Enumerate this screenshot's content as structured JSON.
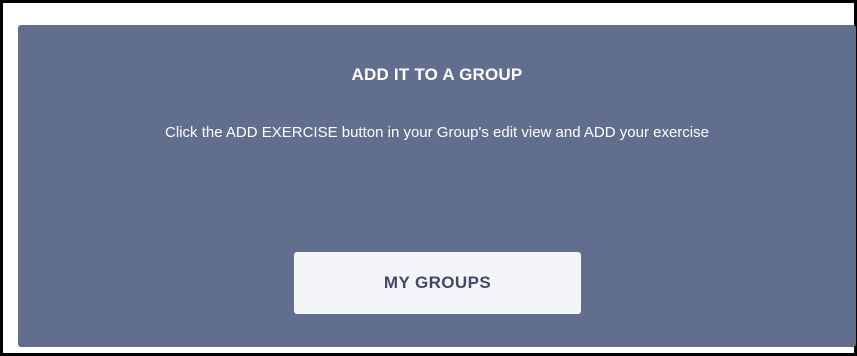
{
  "card": {
    "title": "ADD IT TO A GROUP",
    "description": "Click the ADD EXERCISE button in your Group's edit view and ADD your exercise",
    "button_label": "MY GROUPS"
  },
  "colors": {
    "card_background": "#626e8d",
    "button_background": "#f3f5f9",
    "button_text": "#3f4a66",
    "frame_border": "#000000"
  }
}
